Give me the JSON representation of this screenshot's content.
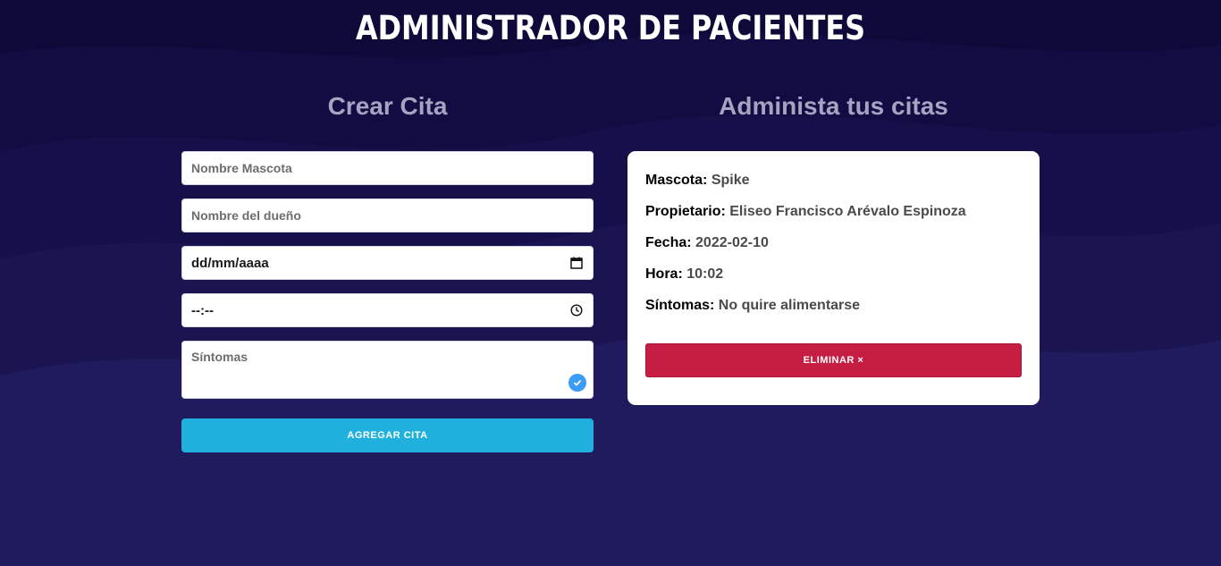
{
  "header": {
    "title": "ADMINISTRADOR DE PACIENTES"
  },
  "form": {
    "title": "Crear Cita",
    "pet_placeholder": "Nombre Mascota",
    "owner_placeholder": "Nombre del dueño",
    "date_value": "dd/mm/aaaa",
    "time_value": "--:--",
    "symptoms_placeholder": "Síntomas",
    "submit_label": "AGREGAR CITA"
  },
  "list": {
    "title": "Administa tus citas",
    "appointment": {
      "pet_label": "Mascota:",
      "pet_value": "Spike",
      "owner_label": "Propietario:",
      "owner_value": "Eliseo Francisco Arévalo Espinoza",
      "date_label": "Fecha:",
      "date_value": "2022-02-10",
      "time_label": "Hora:",
      "time_value": "10:02",
      "symptoms_label": "Síntomas:",
      "symptoms_value": "No quire alimentarse",
      "delete_label": "ELIMINAR ×"
    }
  },
  "colors": {
    "background": "#1b1752",
    "add_button": "#1fb0de",
    "delete_button": "#c51e42",
    "check_badge": "#3b9cf5"
  },
  "icons": {
    "date": "calendar-icon",
    "time": "clock-icon",
    "validation": "check-circle-icon"
  }
}
